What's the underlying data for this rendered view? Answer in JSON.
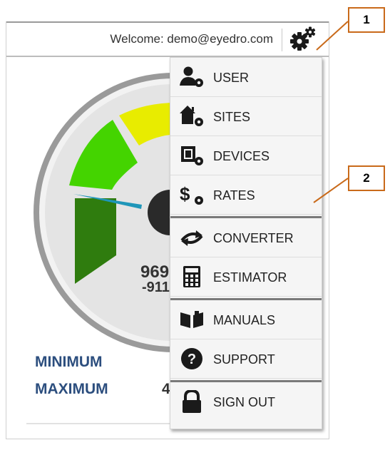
{
  "header": {
    "welcome_text": "Welcome: demo@eyedro.com",
    "settings_icon": "gears-icon"
  },
  "gauge": {
    "value_line1": "969",
    "value_line2": "-911",
    "colors": {
      "dark_green": "#2f7c0e",
      "green": "#44d400",
      "yellow": "#e8ec00",
      "needle": "#1f96b9"
    }
  },
  "stats": {
    "minimum_label": "MINIMUM",
    "maximum_label": "MAXIMUM",
    "maximum_value": "4"
  },
  "menu": {
    "items": [
      {
        "label": "USER",
        "icon": "user-gear-icon"
      },
      {
        "label": "SITES",
        "icon": "house-gear-icon"
      },
      {
        "label": "DEVICES",
        "icon": "chip-gear-icon"
      },
      {
        "label": "RATES",
        "icon": "dollar-gear-icon"
      },
      {
        "label": "CONVERTER",
        "icon": "swap-arrows-icon"
      },
      {
        "label": "ESTIMATOR",
        "icon": "calculator-icon"
      },
      {
        "label": "MANUALS",
        "icon": "book-icon"
      },
      {
        "label": "SUPPORT",
        "icon": "question-icon"
      },
      {
        "label": "SIGN OUT",
        "icon": "lock-icon"
      }
    ]
  },
  "callouts": {
    "one": "1",
    "two": "2",
    "color": "#c96a1a"
  }
}
